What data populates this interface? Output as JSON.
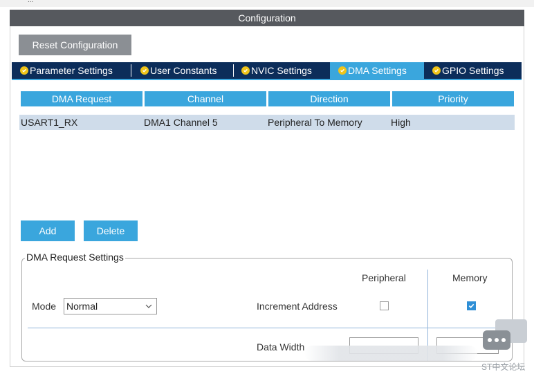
{
  "window": {
    "top_title": "..."
  },
  "config": {
    "title": "Configuration",
    "reset_label": "Reset Configuration"
  },
  "tabs": [
    {
      "label": "Parameter Settings",
      "active": false
    },
    {
      "label": "User Constants",
      "active": false
    },
    {
      "label": "NVIC Settings",
      "active": false
    },
    {
      "label": "DMA Settings",
      "active": true
    },
    {
      "label": "GPIO Settings",
      "active": false
    }
  ],
  "table": {
    "headers": [
      "DMA Request",
      "Channel",
      "Direction",
      "Priority"
    ],
    "rows": [
      [
        "USART1_RX",
        "DMA1 Channel 5",
        "Peripheral To Memory",
        "High"
      ]
    ]
  },
  "buttons": {
    "add": "Add",
    "delete": "Delete"
  },
  "request_settings": {
    "legend": "DMA Request Settings",
    "peripheral_header": "Peripheral",
    "memory_header": "Memory",
    "mode_label": "Mode",
    "mode_value": "Normal",
    "increment_label": "Increment Address",
    "peripheral_increment": false,
    "memory_increment": true,
    "data_width_label": "Data Width"
  },
  "watermark": {
    "text": "ST中文论坛"
  },
  "colors": {
    "accent": "#3aa6dd",
    "tabbar": "#0c2d5a",
    "title_bar": "#56595e",
    "row_selected": "#cfdcea"
  }
}
